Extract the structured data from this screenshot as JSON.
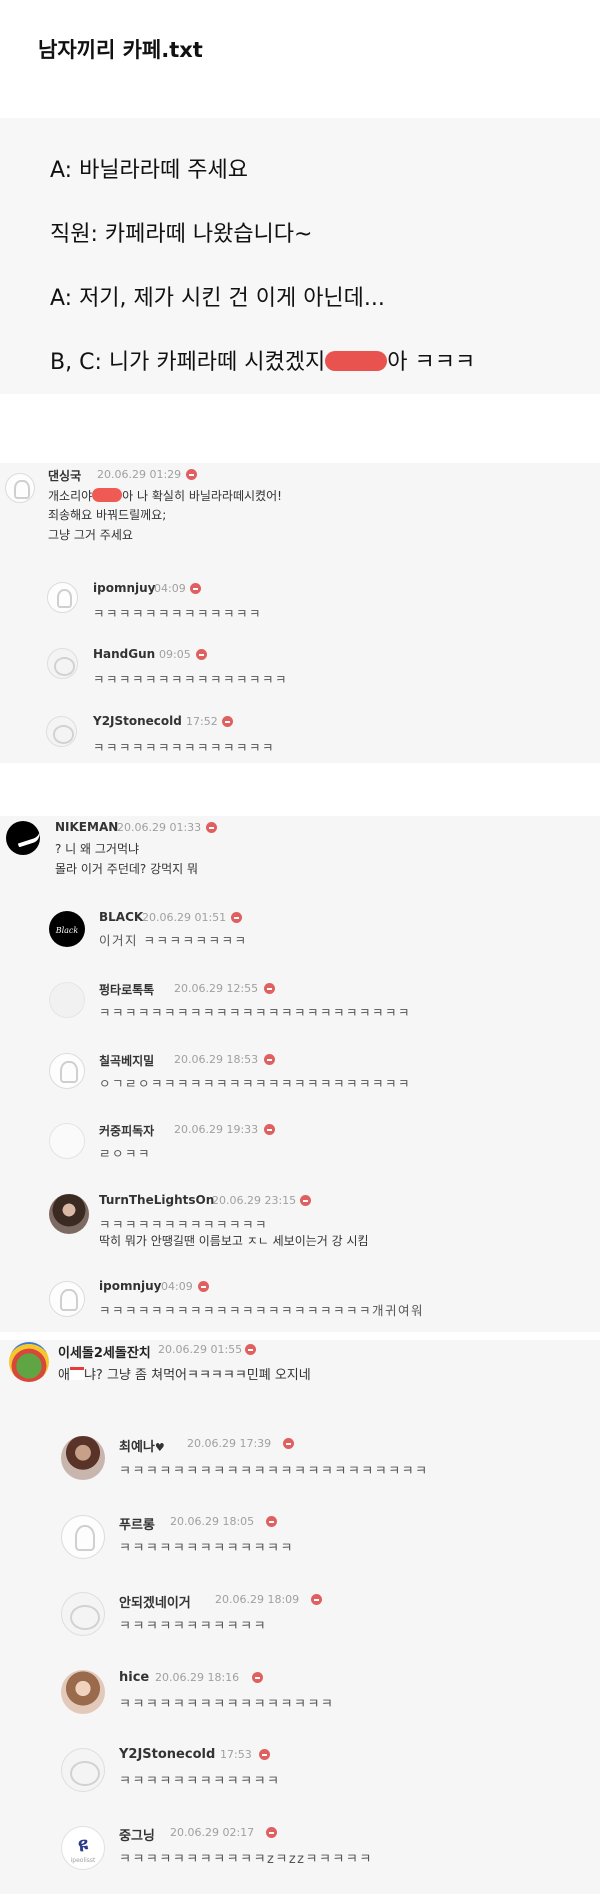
{
  "title": "남자끼리 카페.txt",
  "dialog": [
    {
      "text": "A: 바닐라라떼 주세요"
    },
    {
      "text": "직원: 카페라떼 나왔습니다~"
    },
    {
      "text": "A: 저기, 제가 시킨 건 이게 아닌데..."
    },
    {
      "before": "B, C: 니가 카페라떼 시켰겠지",
      "after": "아 ㅋㅋㅋ"
    }
  ],
  "thread1": {
    "author": {
      "nick": "댄싱국",
      "date": "20.06.29 01:29",
      "line1_a": "개소리야",
      "line1_b": "아 나 확실히 바닐라라떼시켰어!",
      "line2": "죄송해요 바꿔드릴께요;",
      "line3": "그냥 그거 주세요"
    },
    "replies": [
      {
        "nick": "ipomnjuy",
        "date": "04:09",
        "text": "ㅋㅋㅋㅋㅋㅋㅋㅋㅋㅋㅋㅋㅋ"
      },
      {
        "nick": "HandGun",
        "date": "09:05",
        "text": "ㅋㅋㅋㅋㅋㅋㅋㅋㅋㅋㅋㅋㅋㅋㅋ"
      },
      {
        "nick": "Y2JStonecold",
        "date": "17:52",
        "text": "ㅋㅋㅋㅋㅋㅋㅋㅋㅋㅋㅋㅋㅋㅋ"
      }
    ]
  },
  "thread2": {
    "author": {
      "nick": "NIKEMAN",
      "date": "20.06.29 01:33",
      "line1": "? 니 왜 그거먹냐",
      "line2": "몰라 이거 주던데? 강먹지 뭐"
    },
    "replies": [
      {
        "nick": "BLACK",
        "date": "20.06.29 01:51",
        "text": "이거지 ㅋㅋㅋㅋㅋㅋㅋㅋ",
        "logo": "Black"
      },
      {
        "nick": "펑타로톡톡",
        "date": "20.06.29 12:55",
        "text": "ㅋㅋㅋㅋㅋㅋㅋㅋㅋㅋㅋㅋㅋㅋㅋㅋㅋㅋㅋㅋㅋㅋㅋㅋ"
      },
      {
        "nick": "칠곡베지밀",
        "date": "20.06.29 18:53",
        "text": "ㅇㄱㄹㅇㅋㅋㅋㅋㅋㅋㅋㅋㅋㅋㅋㅋㅋㅋㅋㅋㅋㅋㅋㅋ"
      },
      {
        "nick": "커중피독자",
        "date": "20.06.29 19:33",
        "text": "ㄹㅇㅋㅋ"
      },
      {
        "nick": "TurnTheLightsOn",
        "date": "20.06.29 23:15",
        "text": "ㅋㅋㅋㅋㅋㅋㅋㅋㅋㅋㅋㅋㅋ",
        "text2": "딱히 뭐가 안땡길땐 이름보고 ㅈㄴ 세보이는거 강 시킴"
      },
      {
        "nick": "ipomnjuy",
        "date": "04:09",
        "text": "ㅋㅋㅋㅋㅋㅋㅋㅋㅋㅋㅋㅋㅋㅋㅋㅋㅋㅋㅋㅋㅋ개귀여워"
      }
    ]
  },
  "thread3": {
    "author": {
      "nick": "이세돌2세돌잔치",
      "date": "20.06.29 01:55",
      "line1_a": "애",
      "line1_b": "냐? 그냥 좀 쳐먹어ㅋㅋㅋㅋㅋ민폐 오지네"
    },
    "replies": [
      {
        "nick": "최예나",
        "date": "20.06.29 17:39",
        "text": "ㅋㅋㅋㅋㅋㅋㅋㅋㅋㅋㅋㅋㅋㅋㅋㅋㅋㅋㅋㅋㅋㅋㅋ",
        "heart": "♥"
      },
      {
        "nick": "푸르롱",
        "date": "20.06.29 18:05",
        "text": "ㅋㅋㅋㅋㅋㅋㅋㅋㅋㅋㅋㅋㅋ"
      },
      {
        "nick": "안되겠네이거",
        "date": "20.06.29 18:09",
        "text": "ㅋㅋㅋㅋㅋㅋㅋㅋㅋㅋㅋ"
      },
      {
        "nick": "hice",
        "date": "20.06.29 18:16",
        "text": "ㅋㅋㅋㅋㅋㅋㅋㅋㅋㅋㅋㅋㅋㅋㅋㅋ"
      },
      {
        "nick": "Y2JStonecold",
        "date": "17:53",
        "text": "ㅋㅋㅋㅋㅋㅋㅋㅋㅋㅋㅋㅋ"
      },
      {
        "nick": "중그닝",
        "date": "20.06.29 02:17",
        "text": "ㅋㅋㅋㅋㅋㅋㅋㅋㅋㅋㅋzㅋzzㅋㅋㅋㅋㅋ",
        "logo": "ipeolisst"
      }
    ]
  }
}
